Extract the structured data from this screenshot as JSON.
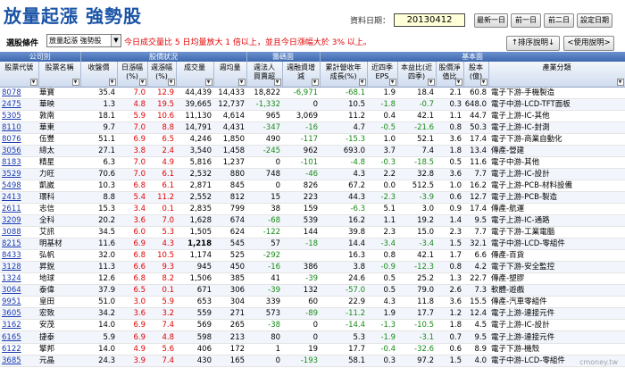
{
  "header": {
    "title": "放量起漲 強勢股",
    "date_label": "資料日期：",
    "date_value": "20130412",
    "nav": [
      "最新一日",
      "前一日",
      "前二日",
      "設定日期"
    ]
  },
  "condition": {
    "label": "選股條件",
    "selected": "放量起漲 強勢股",
    "description": "今日成交量比 5 日均量放大 1 倍以上，並且今日漲幅大於 3% 以上。",
    "sort_button": "↑排序說明↓",
    "explain_button": "<使用說明>"
  },
  "groups": [
    "公司別",
    "股價狀況",
    "籌碼面",
    "基本面"
  ],
  "columns": [
    "股票代號",
    "股票名稱",
    "收盤價",
    "日漲幅\n(%)",
    "週漲幅\n(%)",
    "成交量",
    "週均量",
    "週法人\n買賣超",
    "週融資增\n減",
    "累計營收年\n成長(%)",
    "近四季\nEPS",
    "本益比(近\n四季)",
    "股價淨\n值比",
    "股本\n(億)",
    "產業分類"
  ],
  "rows": [
    [
      "8078",
      "華寶",
      "35.4",
      "7.0",
      "12.9",
      "44,439",
      "14,433",
      "18,822",
      "-6,971",
      "-68.1",
      "1.9",
      "18.4",
      "2.1",
      "60.8",
      "電子下游-手機製造"
    ],
    [
      "2475",
      "華映",
      "1.3",
      "4.8",
      "19.5",
      "39,665",
      "12,737",
      "-1,332",
      "0",
      "10.5",
      "-1.8",
      "-0.7",
      "0.3",
      "648.0",
      "電子中游-LCD-TFT面板"
    ],
    [
      "5305",
      "敦南",
      "18.1",
      "5.9",
      "10.6",
      "11,130",
      "4,614",
      "965",
      "3,069",
      "11.2",
      "0.4",
      "42.1",
      "1.1",
      "44.7",
      "電子上游-IC-其他"
    ],
    [
      "8110",
      "華東",
      "9.7",
      "7.0",
      "8.8",
      "14,791",
      "4,431",
      "-347",
      "-16",
      "4.7",
      "-0.5",
      "-21.6",
      "0.8",
      "50.3",
      "電子上游-IC-封測"
    ],
    [
      "8076",
      "伍豐",
      "51.1",
      "6.9",
      "6.5",
      "4,246",
      "1,850",
      "490",
      "-117",
      "-15.3",
      "1.0",
      "52.1",
      "3.6",
      "17.4",
      "電子下游-商業自動化"
    ],
    [
      "3056",
      "總太",
      "27.1",
      "3.8",
      "2.4",
      "3,540",
      "1,458",
      "-245",
      "962",
      "693.0",
      "3.7",
      "7.4",
      "1.8",
      "13.4",
      "傳產-營建"
    ],
    [
      "8183",
      "精星",
      "6.3",
      "7.0",
      "4.9",
      "5,816",
      "1,237",
      "0",
      "-101",
      "-4.8",
      "-0.3",
      "-18.5",
      "0.5",
      "11.6",
      "電子中游-其他"
    ],
    [
      "3529",
      "力旺",
      "70.6",
      "7.0",
      "6.1",
      "2,532",
      "880",
      "748",
      "-46",
      "4.3",
      "2.2",
      "32.8",
      "3.6",
      "7.7",
      "電子上游-IC-設計"
    ],
    [
      "5498",
      "凱崴",
      "10.3",
      "6.8",
      "6.1",
      "2,871",
      "845",
      "0",
      "826",
      "67.2",
      "0.0",
      "512.5",
      "1.0",
      "16.2",
      "電子上游-PCB-材料設備"
    ],
    [
      "2413",
      "環科",
      "8.8",
      "5.4",
      "11.2",
      "2,552",
      "812",
      "15",
      "223",
      "44.3",
      "-2.3",
      "-3.9",
      "0.6",
      "12.7",
      "電子上游-PCB-製造"
    ],
    [
      "2611",
      "志信",
      "15.3",
      "3.4",
      "0.1",
      "2,835",
      "799",
      "38",
      "159",
      "-6.3",
      "5.1",
      "3.0",
      "0.9",
      "17.4",
      "傳產-航運"
    ],
    [
      "3209",
      "全科",
      "20.2",
      "3.6",
      "7.0",
      "1,628",
      "674",
      "-68",
      "539",
      "16.2",
      "1.1",
      "19.2",
      "1.4",
      "9.5",
      "電子上游-IC-通路"
    ],
    [
      "3088",
      "艾訊",
      "34.5",
      "6.0",
      "5.3",
      "1,505",
      "624",
      "-122",
      "144",
      "39.8",
      "2.3",
      "15.0",
      "2.3",
      "7.7",
      "電子下游-工業電腦"
    ],
    [
      "8215",
      "明基材",
      "11.6",
      "6.9",
      "4.3",
      "1,218",
      "545",
      "57",
      "-18",
      "14.4",
      "-3.4",
      "-3.4",
      "1.5",
      "32.1",
      "電子中游-LCD-零組件"
    ],
    [
      "8433",
      "弘帆",
      "32.0",
      "6.8",
      "10.5",
      "1,174",
      "525",
      "-292",
      "",
      "16.3",
      "0.8",
      "42.1",
      "1.7",
      "6.6",
      "傳產-百貨"
    ],
    [
      "3128",
      "昇銳",
      "11.3",
      "6.6",
      "9.3",
      "945",
      "450",
      "-16",
      "386",
      "3.8",
      "-0.9",
      "-12.3",
      "0.8",
      "4.2",
      "電子下游-安全監控"
    ],
    [
      "1324",
      "地球",
      "12.6",
      "6.8",
      "8.2",
      "1,506",
      "385",
      "41",
      "-39",
      "24.6",
      "0.5",
      "25.2",
      "1.3",
      "22.7",
      "傳產-塑膠"
    ],
    [
      "3064",
      "泰偉",
      "37.9",
      "6.5",
      "0.1",
      "671",
      "306",
      "-39",
      "132",
      "-57.0",
      "0.5",
      "79.0",
      "2.6",
      "7.3",
      "軟體-遊戲"
    ],
    [
      "9951",
      "皇田",
      "51.0",
      "3.0",
      "5.9",
      "653",
      "304",
      "339",
      "60",
      "22.9",
      "4.3",
      "11.8",
      "3.6",
      "15.5",
      "傳產-汽車零組件"
    ],
    [
      "3605",
      "宏致",
      "34.2",
      "3.6",
      "3.2",
      "559",
      "271",
      "573",
      "-89",
      "-11.2",
      "1.9",
      "17.7",
      "1.2",
      "12.4",
      "電子上游-連接元件"
    ],
    [
      "3162",
      "安茂",
      "14.0",
      "6.9",
      "7.4",
      "569",
      "265",
      "-38",
      "0",
      "-14.4",
      "-1.3",
      "-10.5",
      "1.8",
      "4.5",
      "電子上游-IC-設計"
    ],
    [
      "6165",
      "捷泰",
      "5.9",
      "6.9",
      "4.8",
      "598",
      "213",
      "80",
      "0",
      "5.3",
      "-1.9",
      "-3.1",
      "0.7",
      "9.5",
      "電子上游-連接元件"
    ],
    [
      "6122",
      "擎邦",
      "14.0",
      "4.9",
      "5.6",
      "406",
      "172",
      "1",
      "19",
      "17.7",
      "-0.4",
      "-32.6",
      "0.6",
      "8.9",
      "電子下游-機殼"
    ],
    [
      "3685",
      "元晶",
      "24.3",
      "3.9",
      "7.4",
      "430",
      "165",
      "0",
      "-193",
      "58.1",
      "0.3",
      "97.2",
      "1.5",
      "4.0",
      "電子中游-LCD-零組件"
    ]
  ],
  "watermark": "cmoney.tw",
  "colors": {
    "title_blue": "#1a54a6",
    "up_red": "#e00000",
    "down_green": "#178a17",
    "group_header": "#4a74b8"
  }
}
